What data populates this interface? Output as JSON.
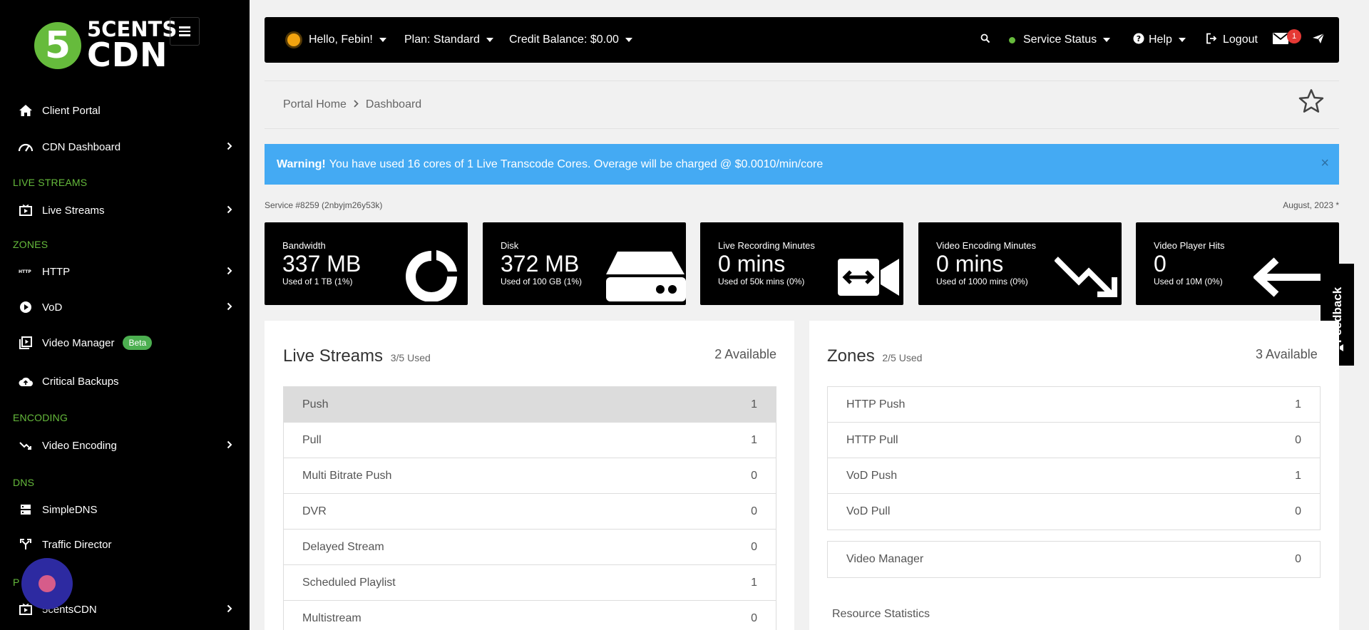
{
  "brand": {
    "logo_digit": "5",
    "logo_line1": "5CENTS",
    "logo_line2": "CDN"
  },
  "sidebar": {
    "client_portal": "Client Portal",
    "cdn_dashboard": "CDN Dashboard",
    "section_live": "LIVE STREAMS",
    "live_streams": "Live Streams",
    "section_zones": "ZONES",
    "http": "HTTP",
    "vod": "VoD",
    "video_manager": "Video Manager",
    "beta": "Beta",
    "critical_backups": "Critical Backups",
    "section_encoding": "ENCODING",
    "video_encoding": "Video Encoding",
    "section_dns": "DNS",
    "simpledns": "SimpleDNS",
    "traffic_director": "Traffic Director",
    "section_partial": "P",
    "fivecentscdn": "5centsCDN"
  },
  "topbar": {
    "greeting": "Hello, Febin!",
    "plan": "Plan: Standard",
    "credit": "Credit Balance: $0.00",
    "service_status": "Service Status",
    "help": "Help",
    "logout": "Logout",
    "mail_count": "1"
  },
  "breadcrumb": {
    "home": "Portal Home",
    "current": "Dashboard"
  },
  "warning": {
    "label": "Warning!",
    "text": "You have used 16 cores of 1 Live Transcode Cores. Overage will be charged @ $0.0010/min/core",
    "close": "×"
  },
  "service": {
    "id": "Service #8259 (2nbyjm26y53k)",
    "period": "August, 2023 *"
  },
  "stats": [
    {
      "label": "Bandwidth",
      "value": "337 MB",
      "sub": "Used of 1 TB (1%)"
    },
    {
      "label": "Disk",
      "value": "372 MB",
      "sub": "Used of 100 GB (1%)"
    },
    {
      "label": "Live Recording Minutes",
      "value": "0 mins",
      "sub": "Used of 50k mins (0%)"
    },
    {
      "label": "Video Encoding Minutes",
      "value": "0 mins",
      "sub": "Used of 1000 mins (0%)"
    },
    {
      "label": "Video Player Hits",
      "value": "0",
      "sub": "Used of 10M (0%)"
    }
  ],
  "feedback": "Feedback",
  "live_streams": {
    "title": "Live Streams",
    "used": "3/5 Used",
    "available": "2 Available",
    "rows": [
      {
        "label": "Push",
        "count": "1"
      },
      {
        "label": "Pull",
        "count": "1"
      },
      {
        "label": "Multi Bitrate Push",
        "count": "0"
      },
      {
        "label": "DVR",
        "count": "0"
      },
      {
        "label": "Delayed Stream",
        "count": "0"
      },
      {
        "label": "Scheduled Playlist",
        "count": "1"
      },
      {
        "label": "Multistream",
        "count": "0"
      }
    ]
  },
  "zones": {
    "title": "Zones",
    "used": "2/5 Used",
    "available": "3 Available",
    "rows": [
      {
        "label": "HTTP Push",
        "count": "1"
      },
      {
        "label": "HTTP Pull",
        "count": "0"
      },
      {
        "label": "VoD Push",
        "count": "1"
      },
      {
        "label": "VoD Pull",
        "count": "0"
      }
    ],
    "video_manager": {
      "label": "Video Manager",
      "count": "0"
    },
    "resource_title": "Resource Statistics"
  }
}
